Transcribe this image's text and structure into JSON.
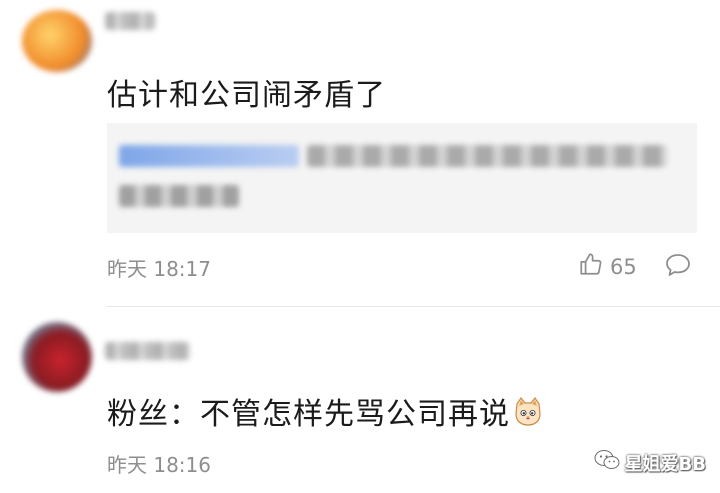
{
  "comment1": {
    "text": "估计和公司闹矛盾了",
    "time": "昨天 18:17",
    "likes": "65"
  },
  "comment2": {
    "text": "粉丝：不管怎样先骂公司再说",
    "time": "昨天 18:16"
  },
  "icons": {
    "like": "thumbs-up-icon",
    "reply": "comment-bubble-icon",
    "emoji": "cat-face-emoji",
    "watermark": "wechat-logo-icon"
  },
  "watermark": {
    "label": "星姐爱BB"
  }
}
